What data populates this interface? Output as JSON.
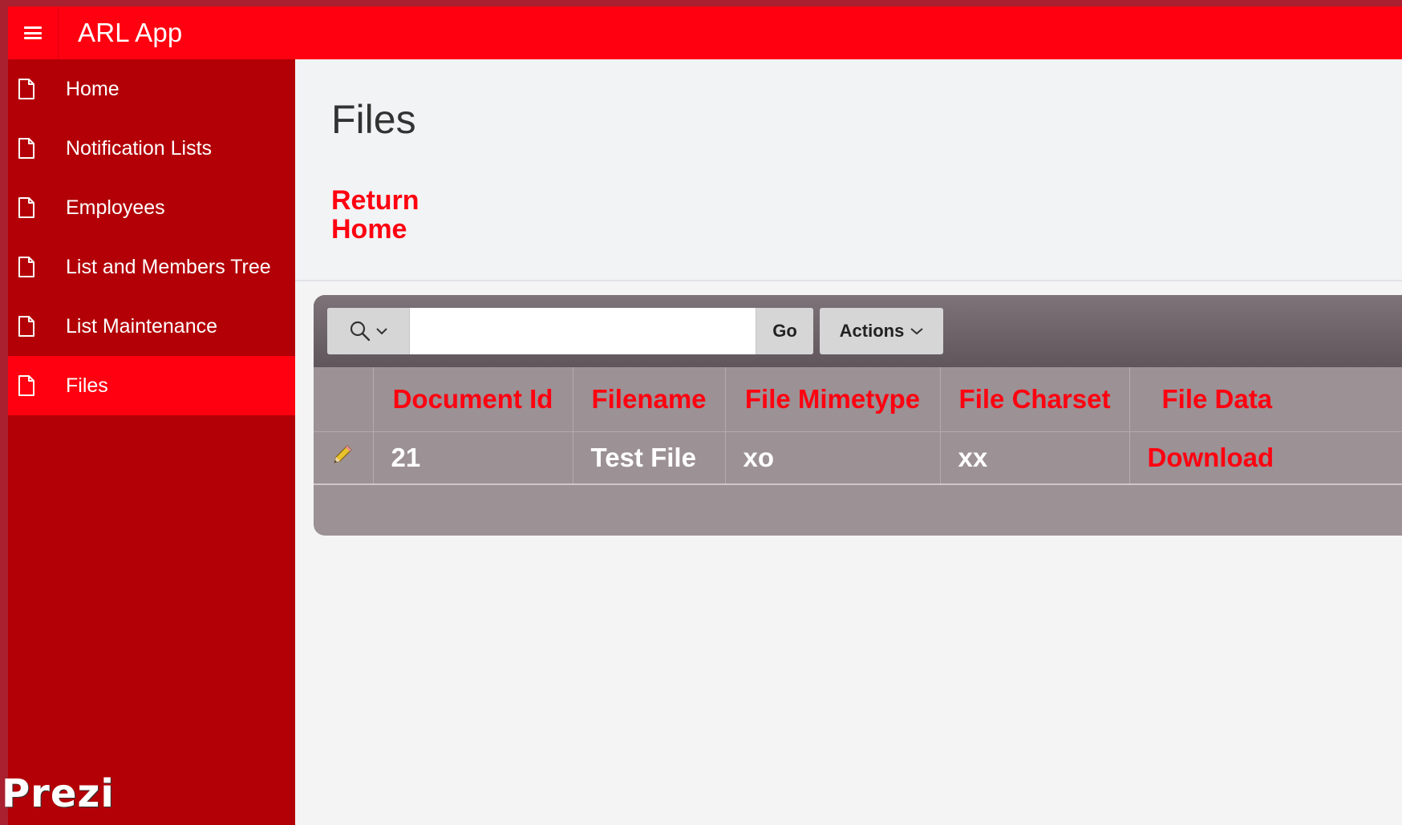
{
  "header": {
    "app_title": "ARL App"
  },
  "sidebar": {
    "items": [
      {
        "label": "Home",
        "icon": "page-icon",
        "active": false
      },
      {
        "label": "Notification Lists",
        "icon": "page-icon",
        "active": false
      },
      {
        "label": "Employees",
        "icon": "page-icon",
        "active": false
      },
      {
        "label": "List and Members Tree",
        "icon": "page-icon",
        "active": false
      },
      {
        "label": "List Maintenance",
        "icon": "page-icon",
        "active": false
      },
      {
        "label": "Files",
        "icon": "page-icon",
        "active": true
      }
    ]
  },
  "page": {
    "title": "Files",
    "return_link": "Return Home"
  },
  "report": {
    "search": {
      "value": "",
      "placeholder": ""
    },
    "go_label": "Go",
    "actions_label": "Actions",
    "columns": [
      "Document Id",
      "Filename",
      "File Mimetype",
      "File Charset",
      "File Data"
    ],
    "rows": [
      {
        "document_id": "21",
        "filename": "Test File",
        "mimetype": "xo",
        "charset": "xx",
        "file_data": "Download"
      }
    ]
  },
  "watermark": "Prezi",
  "colors": {
    "accent": "#ff0010",
    "sidebar": "#b30006",
    "frame": "#a9202e",
    "report_bg": "#9c9195"
  }
}
